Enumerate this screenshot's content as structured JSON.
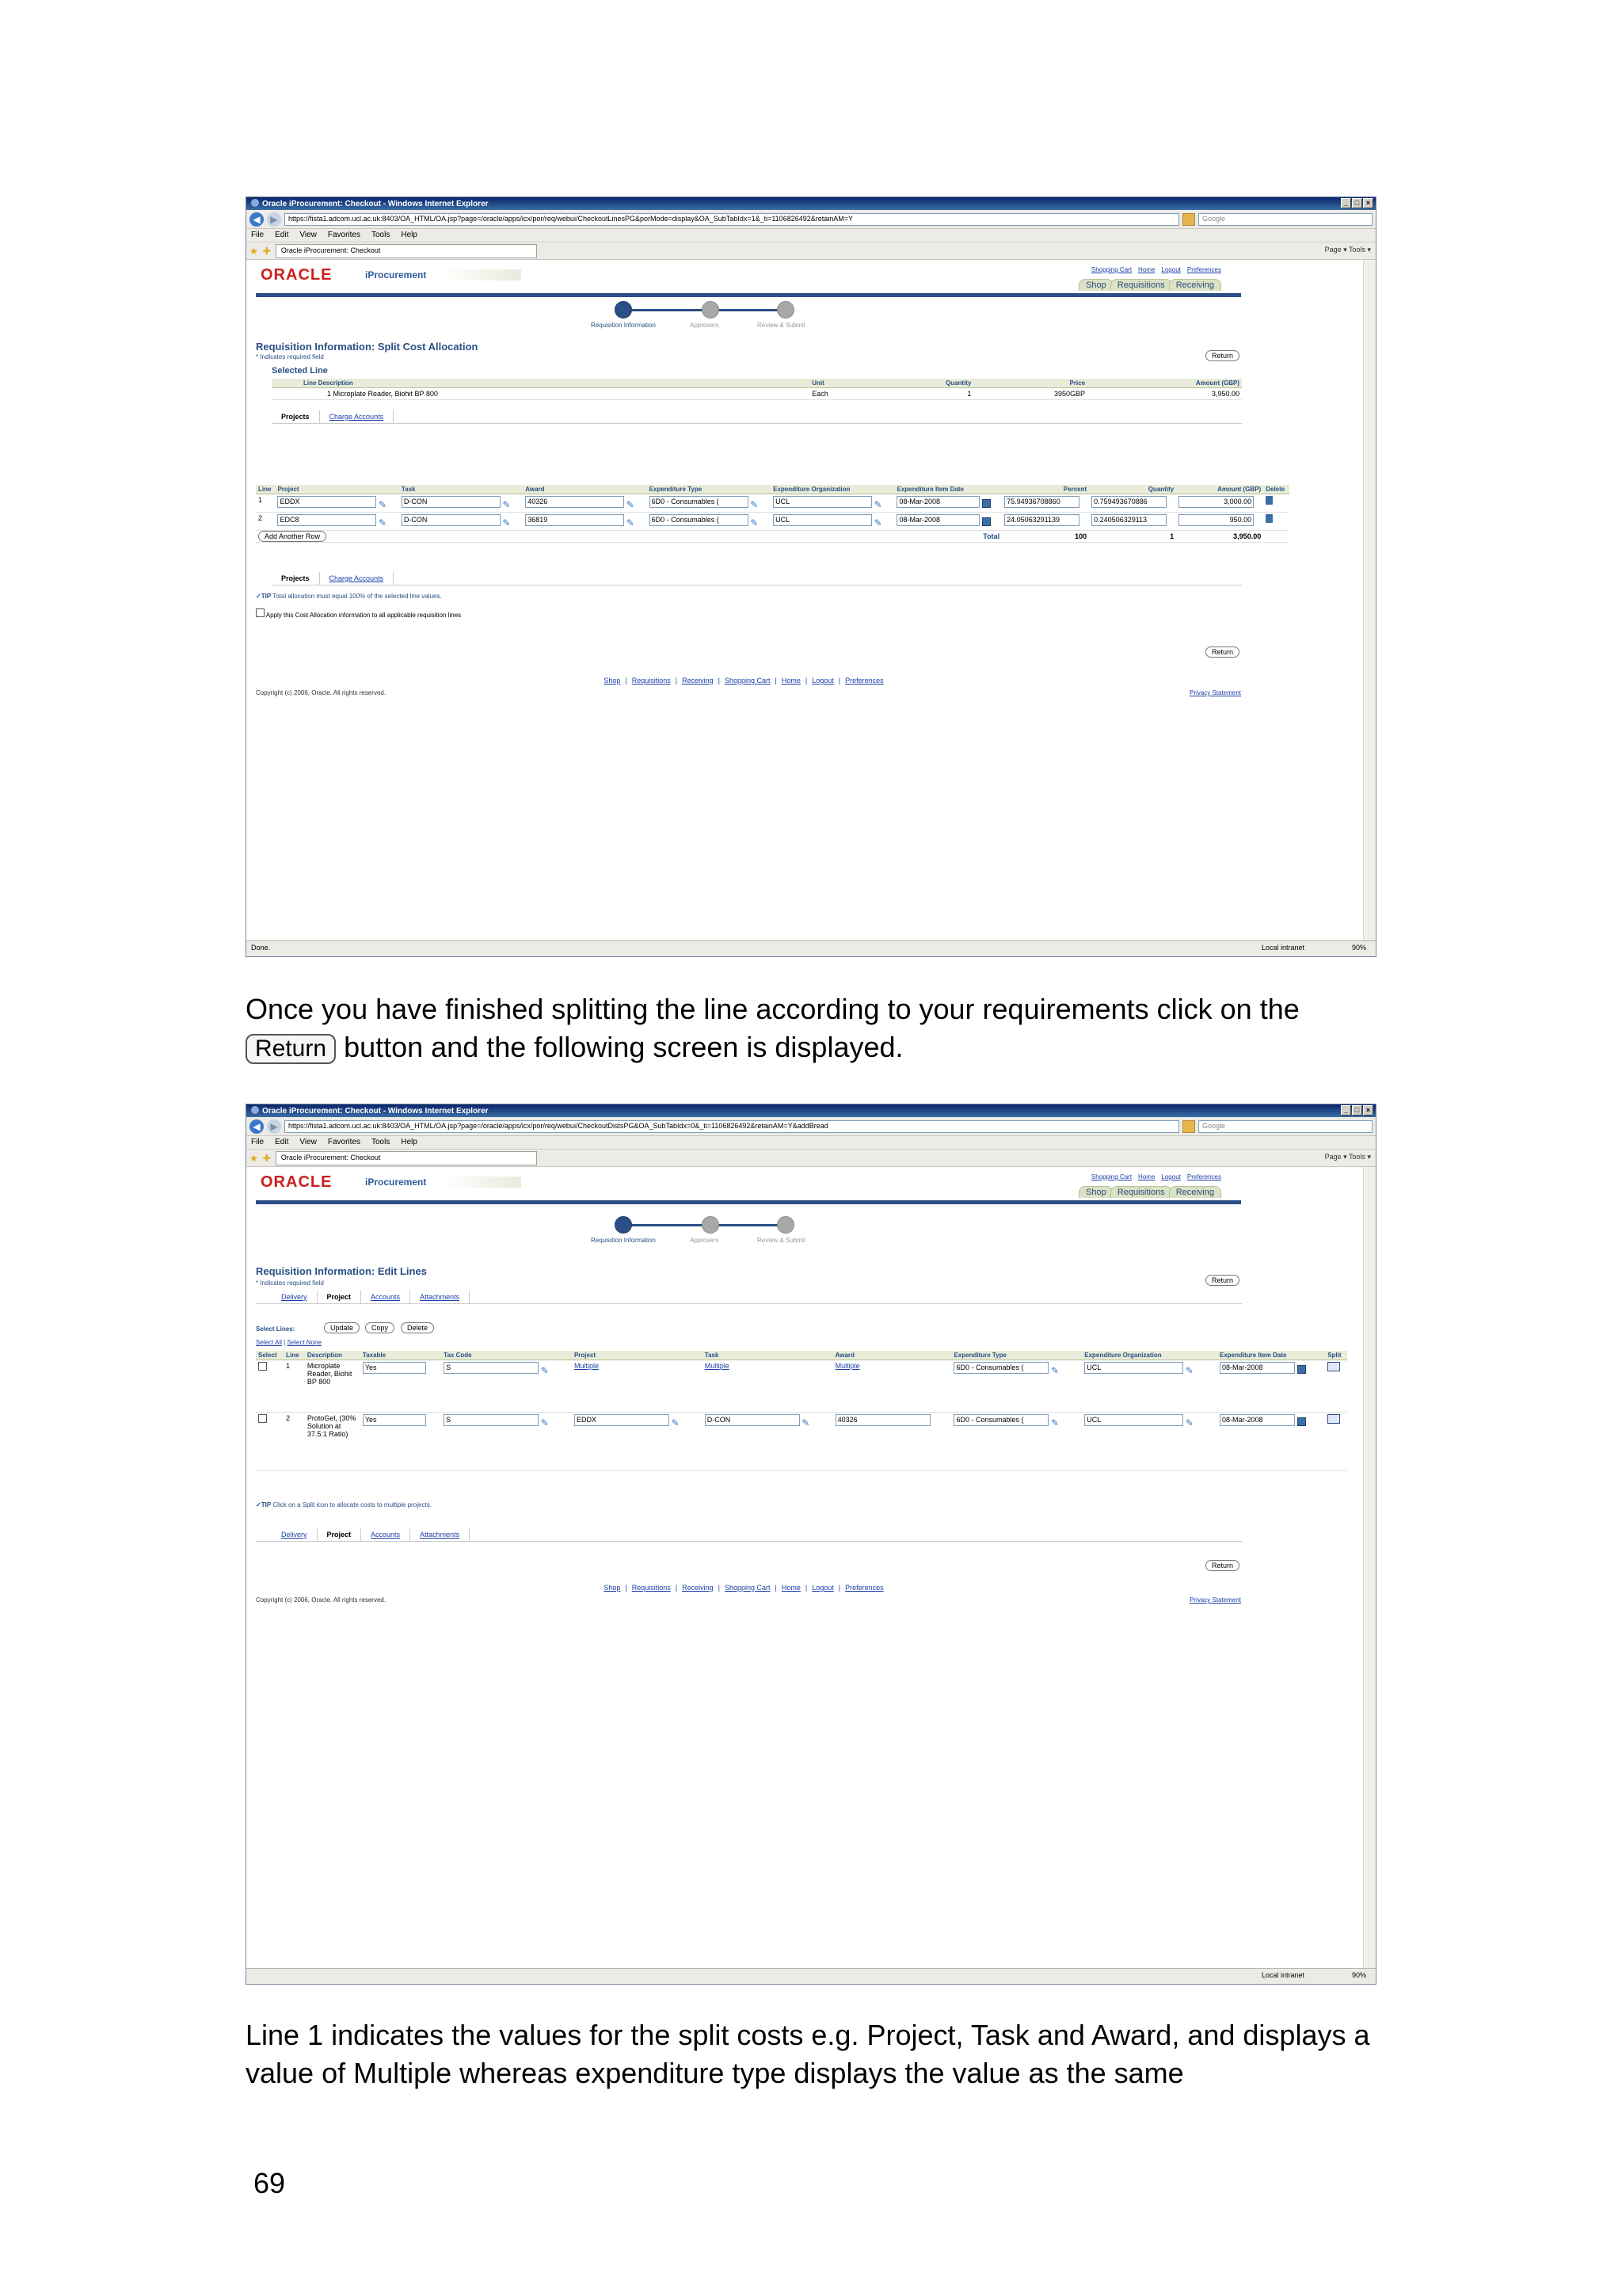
{
  "browser": {
    "window_title": "Oracle iProcurement: Checkout - Windows Internet Explorer",
    "url_1": "https://fista1.adcom.ucl.ac.uk:8403/OA_HTML/OA.jsp?page=/oracle/apps/icx/por/req/webui/CheckoutLinesPG&porMode=display&OA_SubTabIdx=1&_ti=1106826492&retainAM=Y",
    "url_2": "https://fista1.adcom.ucl.ac.uk:8403/OA_HTML/OA.jsp?page=/oracle/apps/icx/por/req/webui/CheckoutDistsPG&OA_SubTabIdx=0&_ti=1106826492&retainAM=Y&addBread",
    "search_placeholder": "Google",
    "menu": [
      "File",
      "Edit",
      "View",
      "Favorites",
      "Tools",
      "Help"
    ],
    "tab_title": "Oracle iProcurement: Checkout",
    "tools_text": "Page ▾  Tools ▾",
    "status_done": "Done.",
    "zone": "Local intranet",
    "zoom": "90%"
  },
  "app": {
    "brand": "ORACLE",
    "product": "iProcurement",
    "top_links": [
      "Shopping Cart",
      "Home",
      "Logout",
      "Preferences"
    ],
    "tabs": [
      "Shop",
      "Requisitions",
      "Receiving"
    ],
    "train": [
      "Requisition Information",
      "Approvers",
      "Review & Submit"
    ],
    "return_label": "Return",
    "required_note": "* Indicates required field",
    "footer_links": [
      "Shop",
      "Requisitions",
      "Receiving",
      "Shopping Cart",
      "Home",
      "Logout",
      "Preferences"
    ],
    "copyright": "Copyright (c) 2006, Oracle. All rights reserved.",
    "privacy": "Privacy Statement"
  },
  "screen1": {
    "heading": "Requisition Information: Split Cost Allocation",
    "selected_line": "Selected Line",
    "sel_headers": [
      "Line Description",
      "Unit",
      "Quantity",
      "Price",
      "Amount (GBP)"
    ],
    "sel_row": [
      "1 Microplate Reader, Biohit BP 800",
      "Each",
      "1",
      "3950GBP",
      "3,950.00"
    ],
    "subtabs": [
      "Projects",
      "Charge Accounts"
    ],
    "headers": [
      "Line",
      "Project",
      "Task",
      "Award",
      "Expenditure Type",
      "Expenditure Organization",
      "Expenditure Item Date",
      "Percent",
      "Quantity",
      "Amount (GBP)",
      "Delete"
    ],
    "rows": [
      [
        "1",
        "EDDX",
        "D-CON",
        "40326",
        "6D0 - Consumables (",
        "UCL",
        "08-Mar-2008",
        "75.94936708860",
        "0.759493670886",
        "3,000.00"
      ],
      [
        "2",
        "EDC8",
        "D-CON",
        "36819",
        "6D0 - Consumables (",
        "UCL",
        "08-Mar-2008",
        "24.05063291139",
        "0.240506329113",
        "950.00"
      ]
    ],
    "add_row": "Add Another Row",
    "total_label": "Total",
    "total_percent": "100",
    "total_qty": "1",
    "total_amount": "3,950.00",
    "tip": "Total allocation must equal 100% of the selected line values.",
    "apply_all": "Apply this Cost Allocation information to all applicable requisition lines"
  },
  "screen2": {
    "heading": "Requisition Information: Edit Lines",
    "subtabs": [
      "Delivery",
      "Project",
      "Accounts",
      "Attachments"
    ],
    "select_lines": "Select Lines:",
    "buttons": [
      "Update",
      "Copy",
      "Delete"
    ],
    "select_all": "Select All",
    "select_none": "Select None",
    "headers": [
      "Select",
      "Line",
      "Description",
      "Taxable",
      "Tax Code",
      "Project",
      "Task",
      "Award",
      "Expenditure Type",
      "Expenditure Organization",
      "Expenditure Item Date",
      "Split"
    ],
    "rows": [
      [
        "1",
        "Microplate Reader, Biohit BP 800",
        "Yes",
        "S",
        "Multiple",
        "Multiple",
        "Multiple",
        "6D0 - Consumables (",
        "UCL",
        "08-Mar-2008"
      ],
      [
        "2",
        "ProtoGel, (30% Solution at 37.5:1 Ratio)",
        "Yes",
        "S",
        "EDDX",
        "D-CON",
        "40326",
        "6D0 - Consumables (",
        "UCL",
        "08-Mar-2008"
      ]
    ],
    "tip": "Click on a Split icon to allocate costs to multiple projects."
  },
  "doc": {
    "para1_a": "Once you have finished splitting the line according to your requirements click on the",
    "para1_btn": "Return",
    "para1_b": "button and the following screen is displayed.",
    "para2": "Line 1 indicates the values for the split costs e.g. Project, Task and Award, and displays a value of Multiple whereas expenditure type displays the value as the same",
    "page_number": "69"
  }
}
